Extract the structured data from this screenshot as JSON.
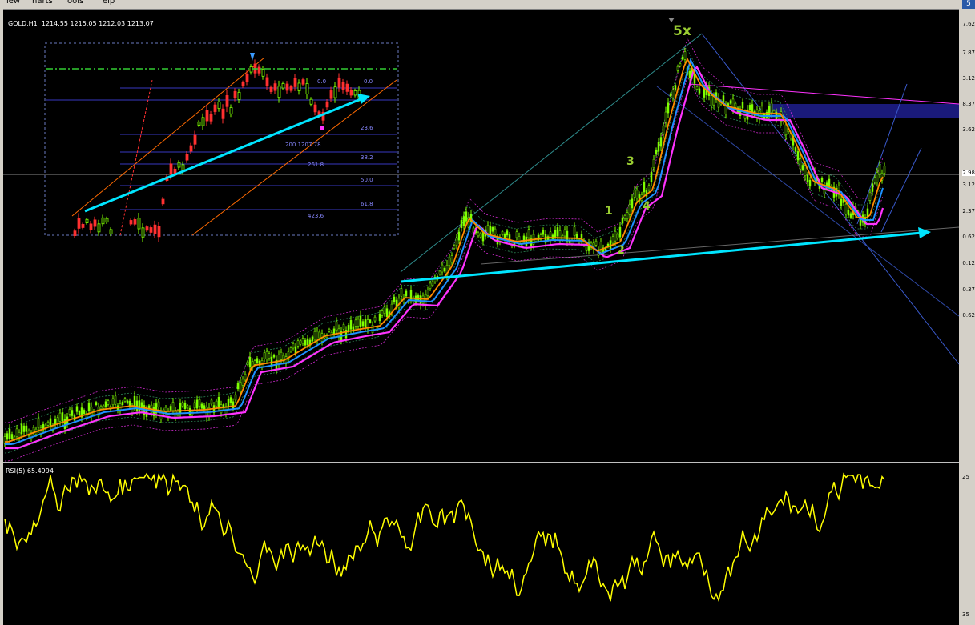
{
  "menu": {
    "items": [
      "iew",
      "harts",
      "ools",
      "elp"
    ]
  },
  "corner_button": "5",
  "chart": {
    "symbol_line": "GOLD,H1  1214.55 1215.05 1212.03 1213.07"
  },
  "rsi": {
    "label": "RSI(5) 65.4994",
    "scale_top": "25",
    "scale_bottom": "35"
  },
  "price_scale": [
    "7.62",
    "7.87",
    "3.12",
    "8.37",
    "3.62",
    "2.98",
    "3.12",
    "2.37",
    "0.62",
    "0.12",
    "0.37",
    "0.62"
  ],
  "waves": {
    "w1": "1",
    "w2": "2",
    "w3": "3",
    "w4": "4",
    "w5": "5x"
  },
  "fib_inset": {
    "levels": [
      "0.0",
      "0.0",
      "23.6",
      "38.2",
      "50.0",
      "61.8",
      "261.8",
      "423.6"
    ],
    "price_text": "200 1207.78"
  },
  "colors": {
    "background": "#000000",
    "candles": "#7fff00",
    "ema_fast": "#ff8c00",
    "ema_mid": "#1e90ff",
    "ema_slow": "#ff33ff",
    "trend_arrow": "#00e5ff",
    "rsi_line": "#ffff00",
    "resistance_zone": "#1a1a7a"
  }
}
